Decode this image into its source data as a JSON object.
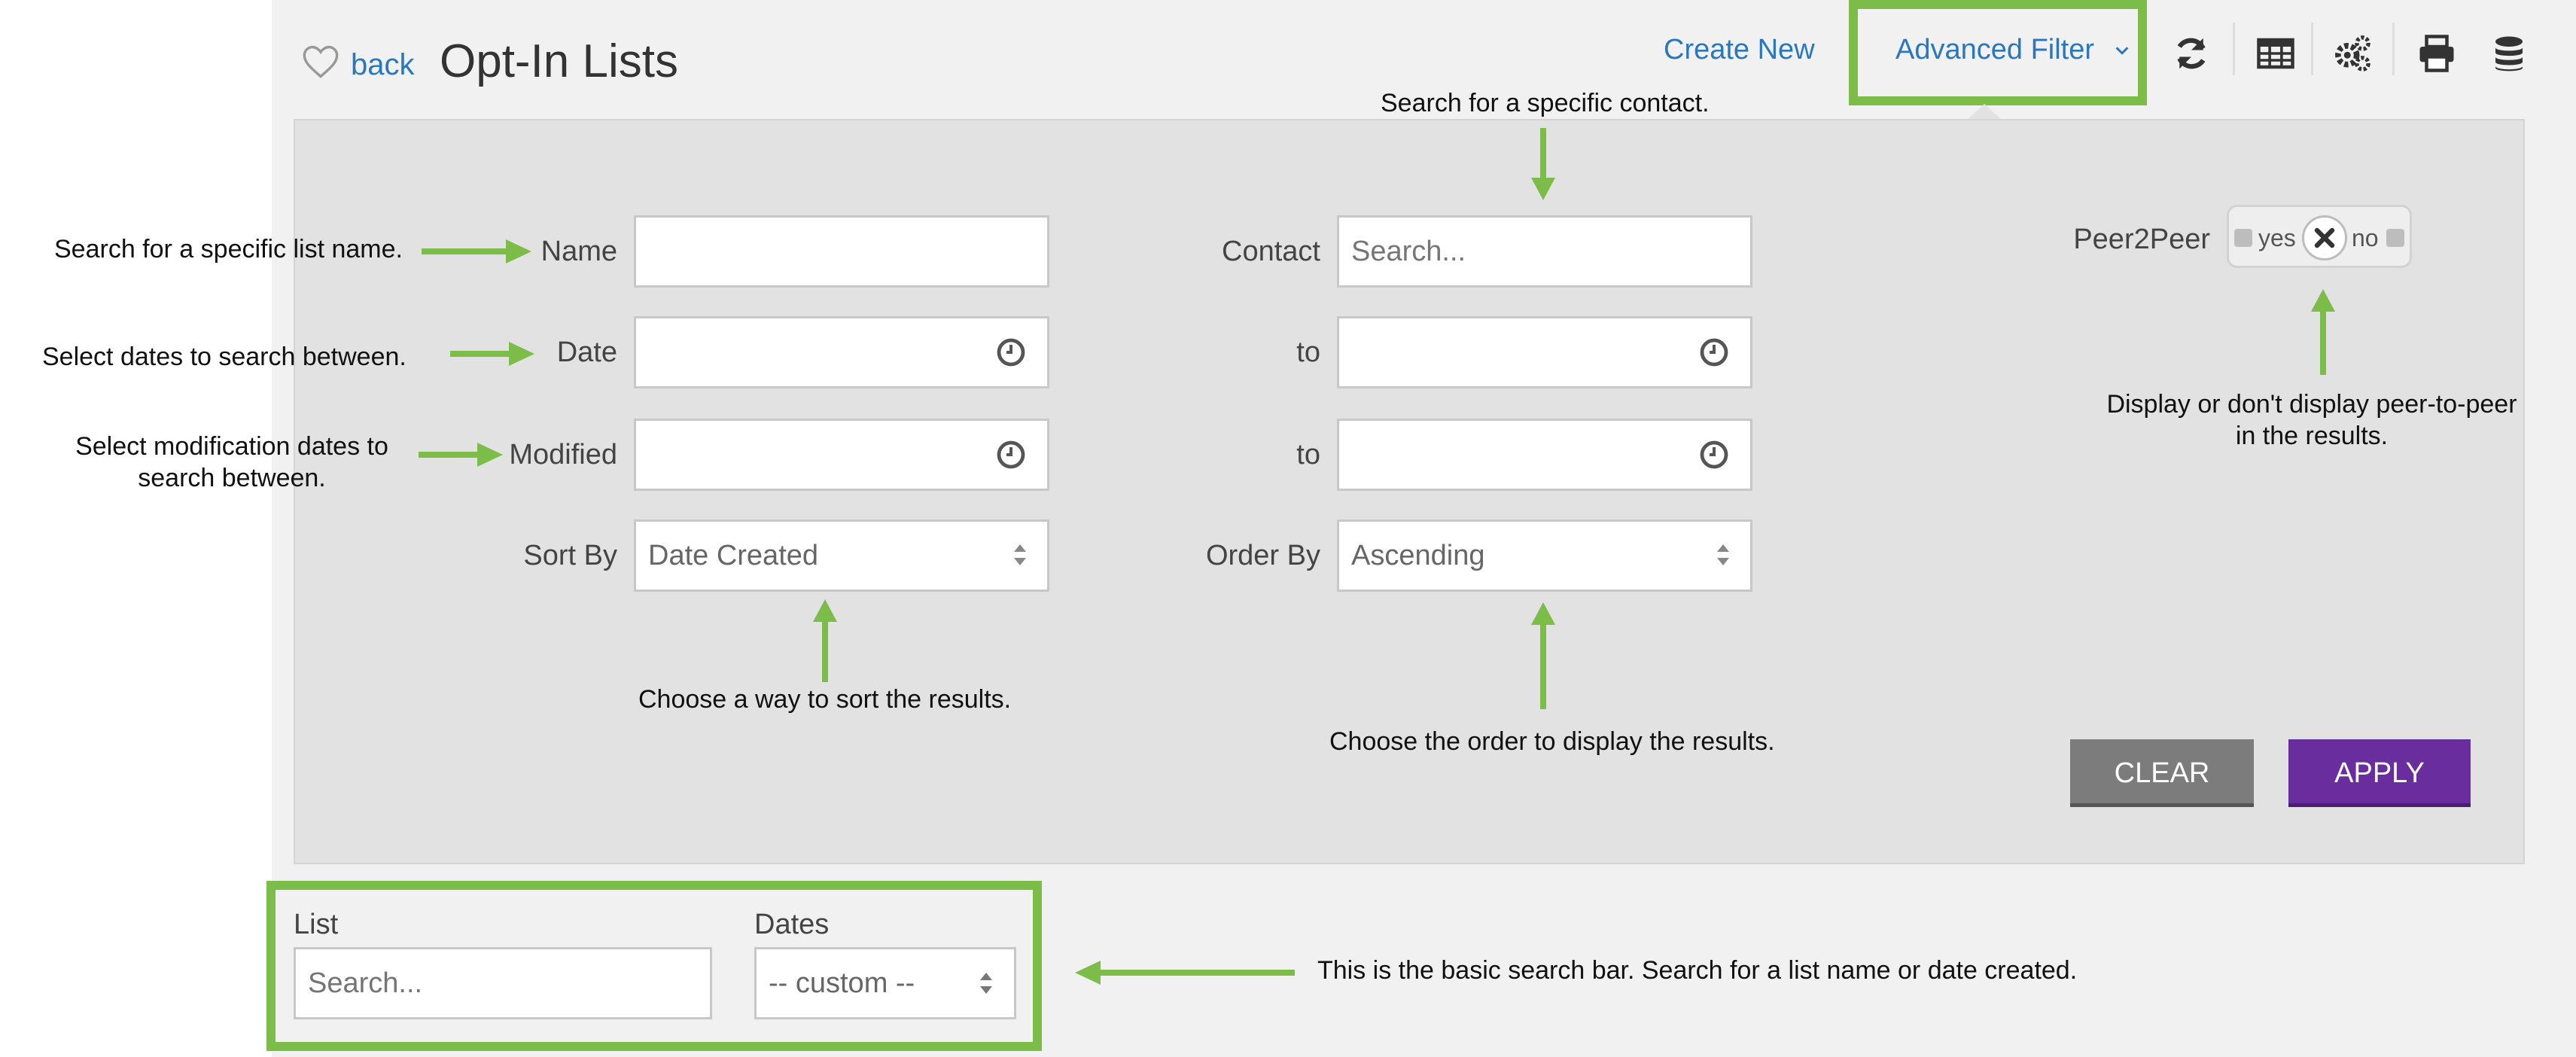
{
  "header": {
    "back_label": "back",
    "title": "Opt-In Lists",
    "create_new_label": "Create New",
    "advanced_filter_label": "Advanced Filter",
    "icons": [
      "heart-icon",
      "chevron-down-icon",
      "refresh-icon",
      "table-icon",
      "gears-icon",
      "print-icon",
      "database-icon"
    ]
  },
  "filter": {
    "name_label": "Name",
    "name_value": "",
    "date_label": "Date",
    "date_value": "",
    "modified_label": "Modified",
    "modified_value": "",
    "sort_by_label": "Sort By",
    "sort_by_value": "Date Created",
    "contact_label": "Contact",
    "contact_placeholder": "Search...",
    "date_to_label": "to",
    "date_to_value": "",
    "modified_to_label": "to",
    "modified_to_value": "",
    "order_by_label": "Order By",
    "order_by_value": "Ascending",
    "peer_label": "Peer2Peer",
    "peer_yes": "yes",
    "peer_no": "no",
    "clear_label": "CLEAR",
    "apply_label": "APPLY"
  },
  "basic_search": {
    "list_label": "List",
    "list_placeholder": "Search...",
    "dates_label": "Dates",
    "dates_value": "-- custom --"
  },
  "annotations": {
    "contact": "Search for a specific contact.",
    "name": "Search for a specific list name.",
    "date": "Select dates to search between.",
    "modified_line1": "Select modification dates to",
    "modified_line2": "search between.",
    "sort": "Choose a way to sort the results.",
    "order": "Choose the order to display the results.",
    "peer_line1": "Display or don't display peer-to-peer",
    "peer_line2": "in the results.",
    "basic": "This is the basic search bar. Search for a list name or date created."
  },
  "colors": {
    "link": "#2a77bd",
    "highlight": "#7cbd4a",
    "apply": "#6a2d9e",
    "clear": "#7c7c7c",
    "panel": "#e2e2e2",
    "background": "#f1f1f1"
  }
}
